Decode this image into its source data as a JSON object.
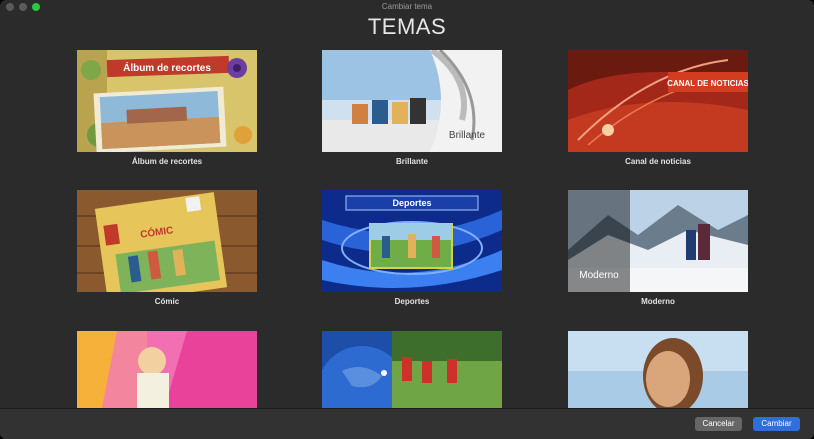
{
  "window": {
    "title": "Cambiar tema",
    "traffic_lights": [
      {
        "name": "close-button",
        "color": "#5a5a5a"
      },
      {
        "name": "minimize-button",
        "color": "#5a5a5a"
      },
      {
        "name": "zoom-button",
        "color": "#28c840"
      }
    ]
  },
  "heading": "TEMAS",
  "themes": [
    {
      "label": "Álbum de recortes",
      "banner": "Álbum de recortes"
    },
    {
      "label": "Brillante",
      "overlay": "Brillante"
    },
    {
      "label": "Canal de noticias",
      "banner": "CANAL DE NOTICIAS"
    },
    {
      "label": "Cómic",
      "badge": "CÓMIC"
    },
    {
      "label": "Deportes",
      "banner": "Deportes"
    },
    {
      "label": "Moderno",
      "overlay": "Moderno"
    },
    {
      "label": ""
    },
    {
      "label": ""
    },
    {
      "label": ""
    }
  ],
  "footer": {
    "cancel_label": "Cancelar",
    "change_label": "Cambiar"
  }
}
